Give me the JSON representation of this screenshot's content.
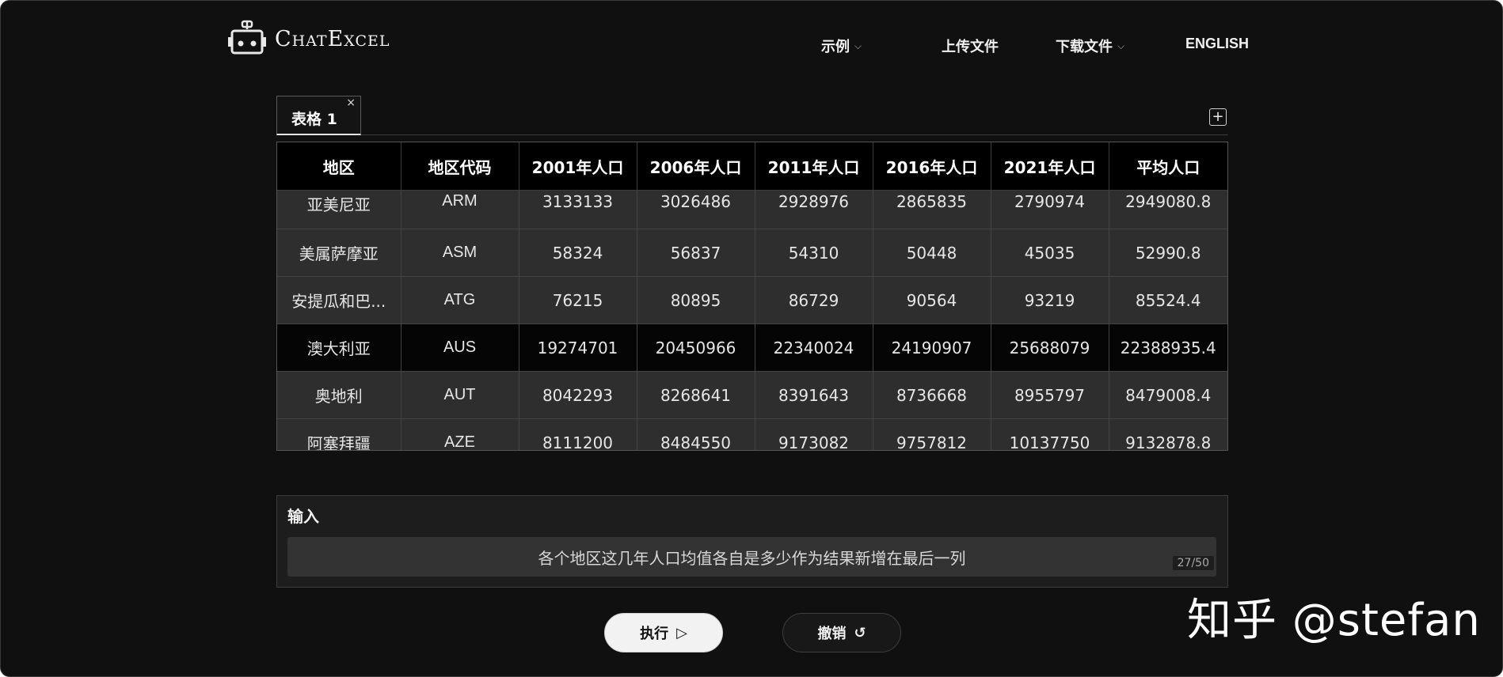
{
  "header": {
    "brand": "ChatExcel",
    "nav": {
      "examples": "示例",
      "upload": "上传文件",
      "download": "下载文件",
      "language": "ENGLISH"
    }
  },
  "tabs": [
    {
      "label": "表格 1",
      "close": "×"
    }
  ],
  "add_tab": "+",
  "table": {
    "columns": [
      "地区",
      "地区代码",
      "2001年人口",
      "2006年人口",
      "2011年人口",
      "2016年人口",
      "2021年人口",
      "平均人口"
    ],
    "rows": [
      [
        "亚美尼亚",
        "ARM",
        "3133133",
        "3026486",
        "2928976",
        "2865835",
        "2790974",
        "2949080.8"
      ],
      [
        "美属萨摩亚",
        "ASM",
        "58324",
        "56837",
        "54310",
        "50448",
        "45035",
        "52990.8"
      ],
      [
        "安提瓜和巴...",
        "ATG",
        "76215",
        "80895",
        "86729",
        "90564",
        "93219",
        "85524.4"
      ],
      [
        "澳大利亚",
        "AUS",
        "19274701",
        "20450966",
        "22340024",
        "24190907",
        "25688079",
        "22388935.4"
      ],
      [
        "奥地利",
        "AUT",
        "8042293",
        "8268641",
        "8391643",
        "8736668",
        "8955797",
        "8479008.4"
      ],
      [
        "阿塞拜疆",
        "AZE",
        "8111200",
        "8484550",
        "9173082",
        "9757812",
        "10137750",
        "9132878.8"
      ]
    ]
  },
  "input": {
    "label": "输入",
    "value": "各个地区这几年人口均值各自是多少作为结果新增在最后一列",
    "counter": "27/50"
  },
  "buttons": {
    "execute": "执行",
    "execute_icon": "▷",
    "undo": "撤销",
    "undo_icon": "↺"
  },
  "watermark": "知乎 @stefan",
  "colors": {
    "background": "#101010",
    "row_gray": "#2e2e2e",
    "row_dark": "#050505",
    "header_bg": "#000000",
    "execute_bg": "#f2f2f2"
  }
}
